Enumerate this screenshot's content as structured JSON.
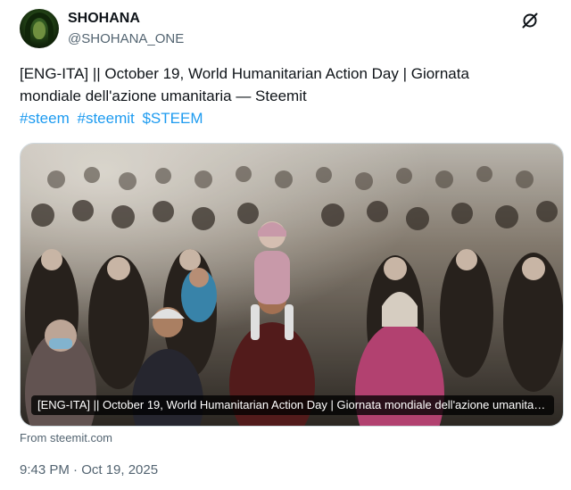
{
  "author": {
    "display_name": "SHOHANA",
    "handle": "@SHOHANA_ONE"
  },
  "tweet": {
    "line1": "[ENG-ITA] ||  October 19, World Humanitarian Action Day |  Giornata",
    "line2": "mondiale dell'azione umanitaria — Steemit",
    "hashtags": [
      "#steem",
      "#steemit",
      "$STEEM"
    ]
  },
  "card": {
    "title": "[ENG-ITA] || October 19, World Humanitarian Action Day | Giornata mondiale dell'azione umanitaria — Steemit",
    "source": "From steemit.com"
  },
  "timestamp": "9:43 PM · Oct 19, 2025",
  "icons": {
    "grok": "grok-icon"
  },
  "colors": {
    "link": "#1d9bf0",
    "secondary_text": "#536471"
  }
}
